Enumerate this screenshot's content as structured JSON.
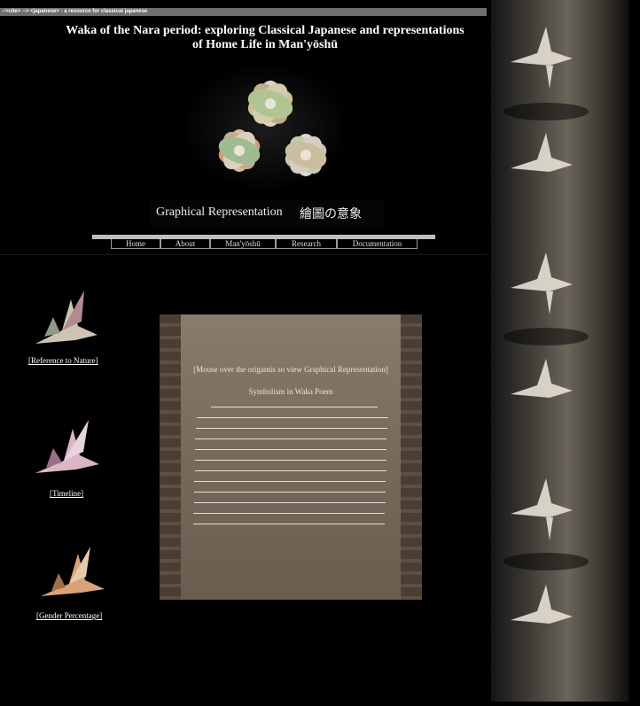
{
  "topbar": {
    "text": "-->cite> --> <japanese> : a resource for classical japanese"
  },
  "header": {
    "title_line1": "Waka of the Nara period: exploring Classical Japanese and representations",
    "title_line2": "of Home Life in Man'yōshū"
  },
  "subtitle": {
    "en": "Graphical Representation",
    "jp": "繪圖の意象"
  },
  "nav": {
    "items": [
      {
        "label": "Home"
      },
      {
        "label": "About"
      },
      {
        "label": "Man'yōshū"
      },
      {
        "label": "Research"
      },
      {
        "label": "Documentation"
      }
    ]
  },
  "sidebar": {
    "items": [
      {
        "label": "[Reference to Nature]"
      },
      {
        "label": "[Timeline]"
      },
      {
        "label": "[Gender Percentage]"
      }
    ]
  },
  "panel": {
    "hint": "[Mouse over the origamis so view Graphical Representation]",
    "heading": "Symbolism in Waka Poem"
  },
  "colors": {
    "background": "#000000",
    "panel": "#7a6c5e",
    "topbar": "#6e6e6e"
  }
}
